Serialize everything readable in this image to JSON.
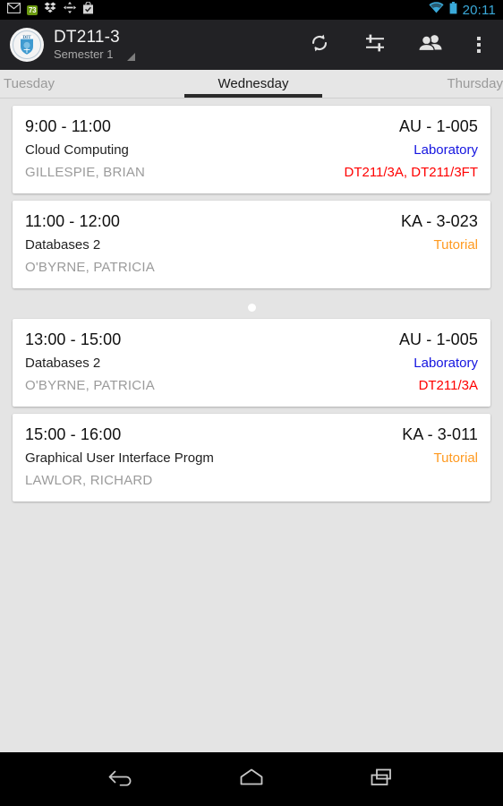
{
  "status_bar": {
    "icons": [
      "gmail-icon",
      "badge-count-icon",
      "dropbox-icon",
      "move-icon",
      "shopping-bag-check-icon"
    ],
    "notification_count": "73",
    "wifi_icon": "wifi-icon",
    "battery_icon": "battery-icon",
    "clock": "20:11",
    "clock_color": "#3aa9d9"
  },
  "action_bar": {
    "logo": "dit-crest-logo",
    "logo_text": "DIT",
    "title": "DT211-3",
    "subtitle": "Semester 1",
    "spinner_icon": "dropdown-triangle-icon",
    "actions": [
      {
        "name": "refresh-button",
        "icon": "refresh-icon",
        "label": "Refresh"
      },
      {
        "name": "filter-button",
        "icon": "sliders-icon",
        "label": "Filter"
      },
      {
        "name": "groups-button",
        "icon": "people-icon",
        "label": "Groups"
      },
      {
        "name": "overflow-button",
        "icon": "overflow-menu-icon",
        "label": "More options"
      }
    ],
    "background": "#222225"
  },
  "tabs": {
    "items": [
      {
        "label": "Tuesday",
        "active": false
      },
      {
        "label": "Wednesday",
        "active": true
      },
      {
        "label": "Thursday",
        "active": false
      }
    ],
    "indicator_color": "#2b2b2b"
  },
  "colors": {
    "laboratory": "#1414e0",
    "tutorial": "#ff9a20",
    "groups": "#ff0000",
    "lecturer": "#9b9b9b",
    "page_background": "#e4e4e4",
    "card_background": "#ffffff"
  },
  "schedule": {
    "day": "Wednesday",
    "entries": [
      {
        "time": "9:00 - 11:00",
        "module": "Cloud Computing",
        "lecturer": "GILLESPIE, BRIAN",
        "room": "AU - 1-005",
        "type": "Laboratory",
        "type_color": "#1414e0",
        "groups": "DT211/3A, DT211/3FT",
        "gap_after": false
      },
      {
        "time": "11:00 - 12:00",
        "module": "Databases 2",
        "lecturer": "O'BYRNE, PATRICIA",
        "room": "KA - 3-023",
        "type": "Tutorial",
        "type_color": "#ff9a20",
        "groups": "",
        "gap_after": true
      },
      {
        "time": "13:00 - 15:00",
        "module": "Databases 2",
        "lecturer": "O'BYRNE, PATRICIA",
        "room": "AU - 1-005",
        "type": "Laboratory",
        "type_color": "#1414e0",
        "groups": "DT211/3A",
        "gap_after": false
      },
      {
        "time": "15:00 - 16:00",
        "module": "Graphical User Interface Progm",
        "lecturer": "LAWLOR, RICHARD",
        "room": "KA - 3-011",
        "type": "Tutorial",
        "type_color": "#ff9a20",
        "groups": "",
        "gap_after": false
      }
    ]
  },
  "nav_bar": {
    "buttons": [
      {
        "name": "back-button",
        "icon": "back-arrow-icon",
        "label": "Back"
      },
      {
        "name": "home-button",
        "icon": "home-icon",
        "label": "Home"
      },
      {
        "name": "recents-button",
        "icon": "recents-icon",
        "label": "Recent apps"
      }
    ]
  }
}
